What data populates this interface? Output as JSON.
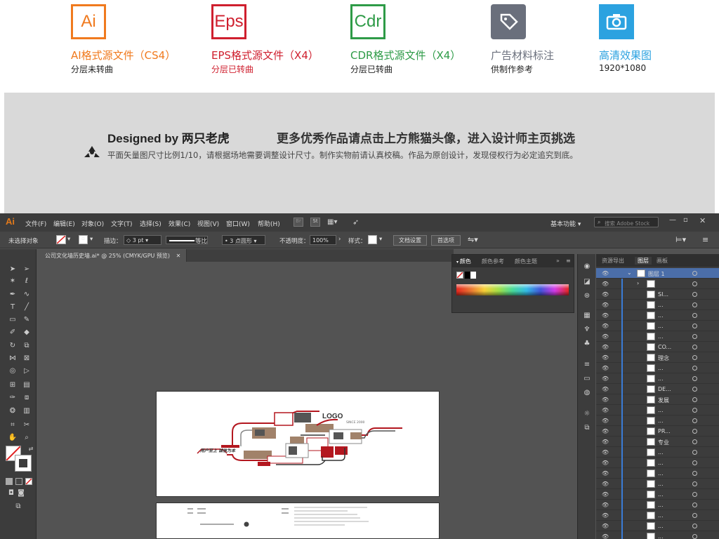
{
  "formats": [
    {
      "icon_text": "Ai",
      "title": "AI格式源文件（CS4）",
      "sub": "分层未转曲",
      "color": "#f07a1e"
    },
    {
      "icon_text": "Eps",
      "title": "EPS格式源文件（X4）",
      "sub": "分层已转曲",
      "color": "#cf1f2e"
    },
    {
      "icon_text": "Cdr",
      "title": "CDR格式源文件（X4）",
      "sub": "分层已转曲",
      "color": "#2e9b47"
    },
    {
      "icon_text": "",
      "title": "广告材料标注",
      "sub": "供制作参考",
      "color": "#6a6f7c"
    },
    {
      "icon_text": "",
      "title": "高清效果图",
      "sub": "1920*1080",
      "color": "#2ba2e0"
    }
  ],
  "banner": {
    "designer": "Designed by 两只老虎",
    "promo": "更多优秀作品请点击上方熊猫头像，进入设计师主页挑选",
    "note": "平面矢量图尺寸比例1/10，请根据场地需要调整设计尺寸。制作实物前请认真校稿。作品为原创设计，发现侵权行为必定追究到底。"
  },
  "menubar": {
    "logo": "Ai",
    "items": [
      "文件(F)",
      "编辑(E)",
      "对象(O)",
      "文字(T)",
      "选择(S)",
      "效果(C)",
      "视图(V)",
      "窗口(W)",
      "帮助(H)"
    ],
    "workspace": "基本功能",
    "search_placeholder": "搜索 Adobe Stock"
  },
  "controlbar": {
    "no_selection": "未选择对象",
    "stroke_label": "描边：",
    "stroke_value": "3 pt",
    "ratio": "等比",
    "brush": "3 点圆形",
    "opacity_label": "不透明度：",
    "opacity_value": "100%",
    "style_label": "样式：",
    "doc_setup": "文档设置",
    "prefs": "首选项"
  },
  "document_tab": "公司文化墙历史墙.ai* @ 25% (CMYK/GPU 预览)",
  "color_panel": {
    "tabs": [
      "颜色",
      "颜色参考",
      "颜色主题"
    ]
  },
  "layers_panel": {
    "tabs": [
      "资源导出",
      "图层",
      "画板"
    ],
    "layer_name": "图层 1",
    "rows": [
      "",
      "SI...",
      "...",
      "...",
      "...",
      "...",
      "CO...",
      "理念",
      "...",
      "...",
      "DE...",
      "发展",
      "...",
      "...",
      "PR...",
      "专业",
      "...",
      "...",
      "...",
      "...",
      "...",
      "...",
      "...",
      "...",
      "..."
    ]
  },
  "artboard": {
    "logo_text": "LOGO",
    "since": "SINCE 2000",
    "slogan": "用户至上 诚信为本"
  },
  "colors": {
    "app_bg": "#535353",
    "accent_red": "#b3171f",
    "accent_brown": "#a1826a"
  }
}
